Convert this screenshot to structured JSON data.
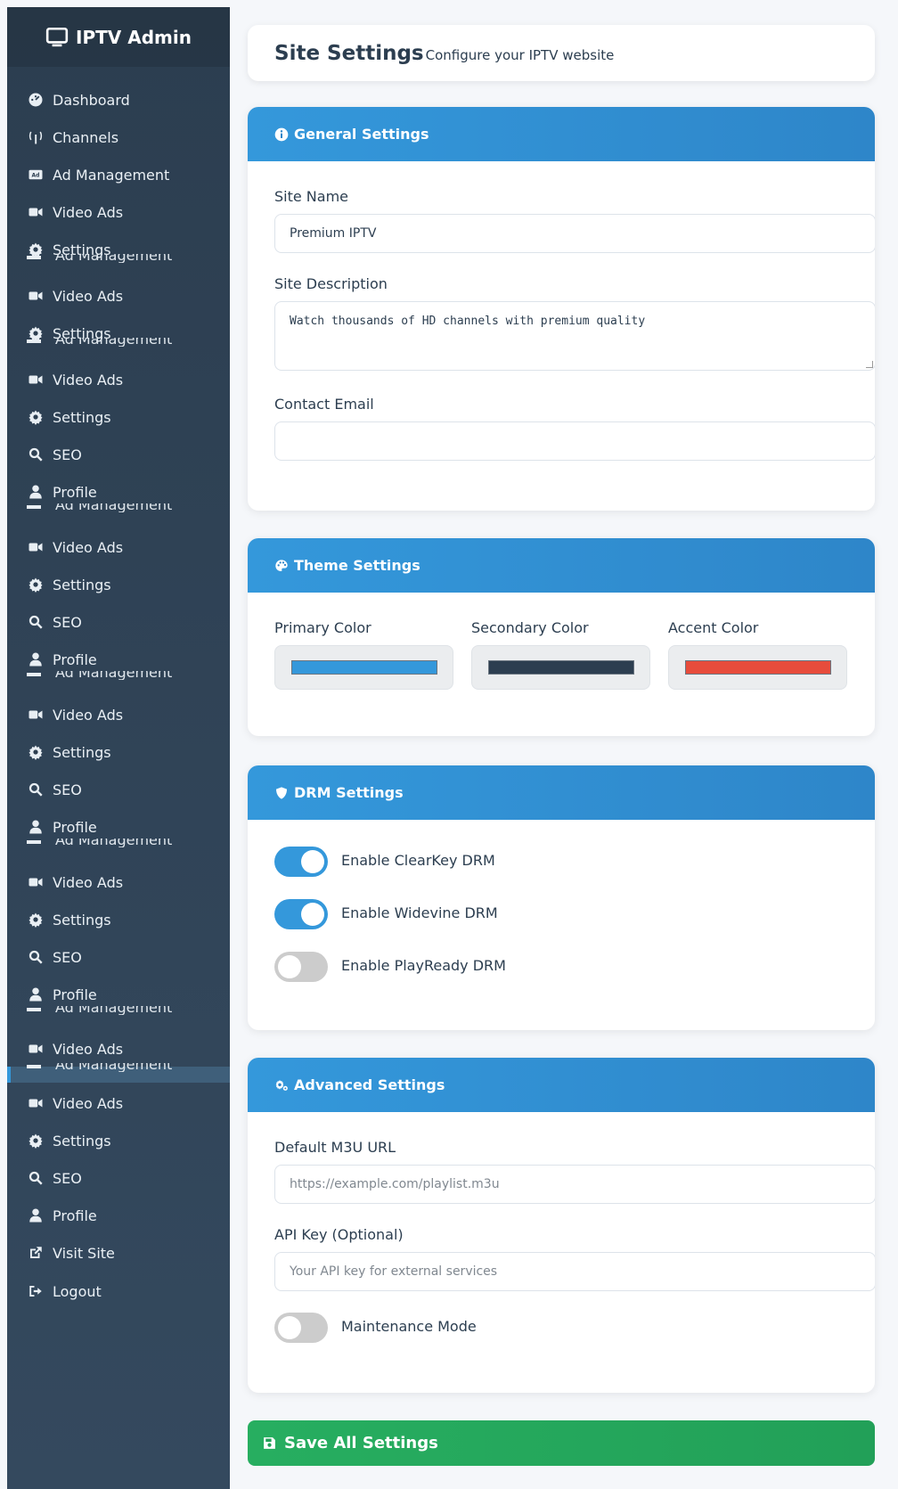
{
  "brand": {
    "title": "IPTV Admin",
    "icon": "monitor-icon"
  },
  "sidebar": {
    "items": [
      {
        "label": "Dashboard",
        "icon": "dashboard-icon"
      },
      {
        "label": "Channels",
        "icon": "antenna-icon"
      },
      {
        "label": "Ad Management",
        "icon": "ad-icon"
      },
      {
        "label": "Video Ads",
        "icon": "video-icon"
      },
      {
        "label": "Settings",
        "icon": "gear-icon"
      },
      {
        "label": "Video Ads",
        "icon": "video-icon"
      },
      {
        "label": "Settings",
        "icon": "gear-icon"
      },
      {
        "label": "Video Ads",
        "icon": "video-icon"
      },
      {
        "label": "Settings",
        "icon": "gear-icon"
      },
      {
        "label": "SEO",
        "icon": "search-icon"
      },
      {
        "label": "Profile",
        "icon": "user-icon"
      },
      {
        "label": "Video Ads",
        "icon": "video-icon"
      },
      {
        "label": "Settings",
        "icon": "gear-icon"
      },
      {
        "label": "SEO",
        "icon": "search-icon"
      },
      {
        "label": "Profile",
        "icon": "user-icon"
      },
      {
        "label": "Video Ads",
        "icon": "video-icon"
      },
      {
        "label": "Settings",
        "icon": "gear-icon"
      },
      {
        "label": "SEO",
        "icon": "search-icon"
      },
      {
        "label": "Profile",
        "icon": "user-icon"
      },
      {
        "label": "Video Ads",
        "icon": "video-icon"
      },
      {
        "label": "Settings",
        "icon": "gear-icon"
      },
      {
        "label": "SEO",
        "icon": "search-icon"
      },
      {
        "label": "Profile",
        "icon": "user-icon"
      },
      {
        "label": "Video Ads",
        "icon": "video-icon"
      },
      {
        "label": "Video Ads",
        "icon": "video-icon"
      },
      {
        "label": "Settings",
        "icon": "gear-icon"
      },
      {
        "label": "SEO",
        "icon": "search-icon"
      },
      {
        "label": "Profile",
        "icon": "user-icon"
      },
      {
        "label": "Visit Site",
        "icon": "external-link-icon"
      },
      {
        "label": "Logout",
        "icon": "logout-icon"
      }
    ],
    "ghost_label": "Ad Management"
  },
  "header": {
    "title": "Site Settings",
    "subtitle": "Configure your IPTV website"
  },
  "general": {
    "title": "General Settings",
    "site_name_label": "Site Name",
    "site_name_value": "Premium IPTV",
    "site_desc_label": "Site Description",
    "site_desc_value": "Watch thousands of HD channels with premium quality",
    "email_label": "Contact Email",
    "email_value": ""
  },
  "theme": {
    "title": "Theme Settings",
    "primary_label": "Primary Color",
    "secondary_label": "Secondary Color",
    "accent_label": "Accent Color",
    "primary_color": "#3498db",
    "secondary_color": "#2c3e50",
    "accent_color": "#e74c3c"
  },
  "drm": {
    "title": "DRM Settings",
    "clearkey_label": "Enable ClearKey DRM",
    "clearkey_on": true,
    "widevine_label": "Enable Widevine DRM",
    "widevine_on": true,
    "playready_label": "Enable PlayReady DRM",
    "playready_on": false
  },
  "advanced": {
    "title": "Advanced Settings",
    "m3u_label": "Default M3U URL",
    "m3u_placeholder": "https://example.com/playlist.m3u",
    "api_label": "API Key (Optional)",
    "api_placeholder": "Your API key for external services",
    "maintenance_label": "Maintenance Mode",
    "maintenance_on": false
  },
  "save_label": "Save All Settings"
}
